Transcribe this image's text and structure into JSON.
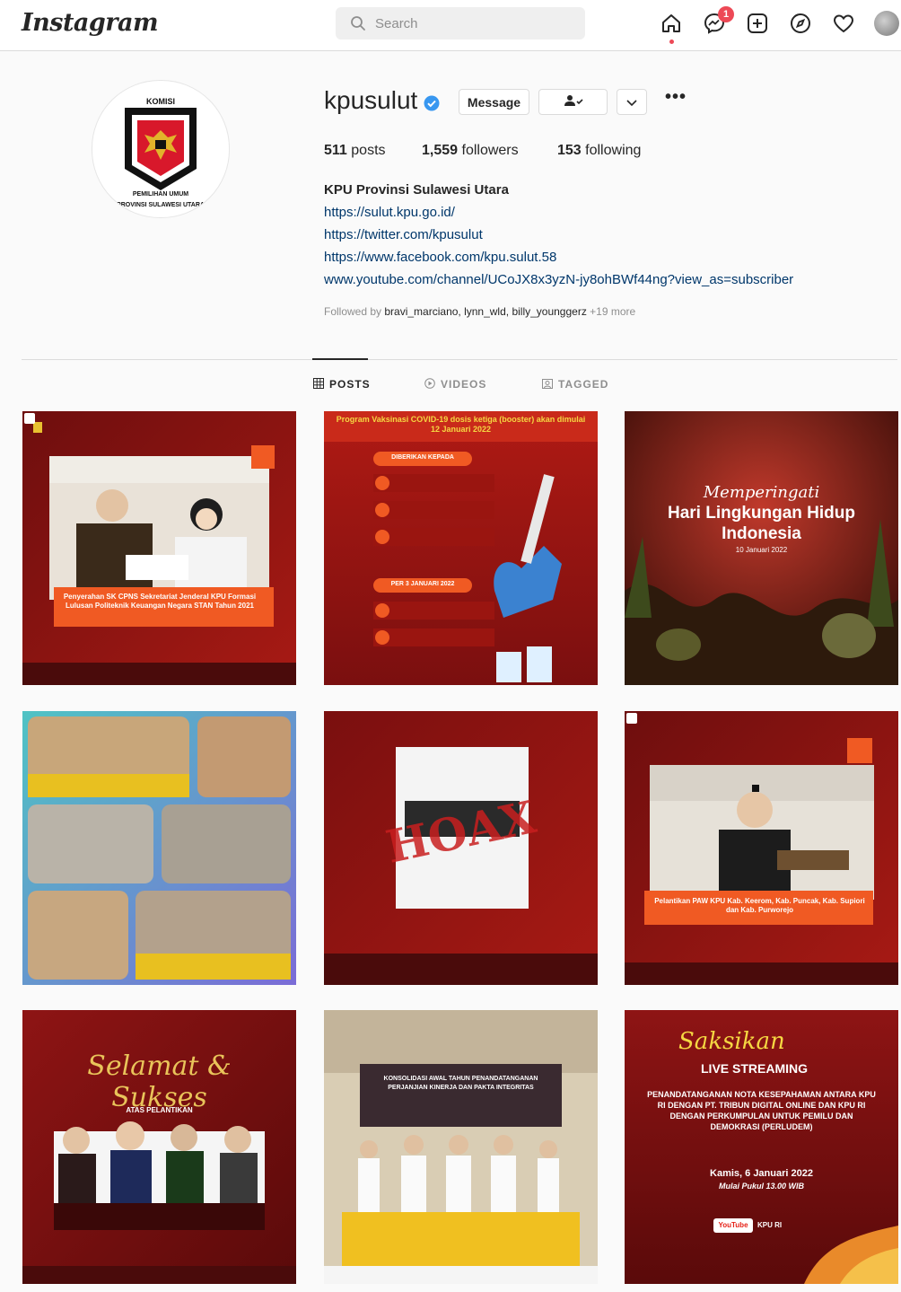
{
  "header": {
    "logo": "Instagram",
    "search_placeholder": "Search",
    "notification_count": "1"
  },
  "profile": {
    "username": "kpusulut",
    "message_label": "Message",
    "stats": [
      {
        "value": "511",
        "label": "posts"
      },
      {
        "value": "1,559",
        "label": "followers"
      },
      {
        "value": "153",
        "label": "following"
      }
    ],
    "logo_top_text": "KOMISI",
    "logo_bottom_text": "PEMILIHAN UMUM",
    "logo_caption": "PROVINSI SULAWESI UTARA",
    "bio_name": "KPU Provinsi Sulawesi Utara",
    "links": [
      "https://sulut.kpu.go.id/",
      "https://twitter.com/kpusulut",
      "https://www.facebook.com/kpu.sulut.58",
      "www.youtube.com/channel/UCoJX8x3yzN-jy8ohBWf44ng?view_as=subscriber"
    ],
    "followed_by_prefix": "Followed by",
    "followed_by_names": "bravi_marciano, lynn_wld, billy_younggerz",
    "followed_by_more": "+19 more"
  },
  "tabs": [
    "POSTS",
    "VIDEOS",
    "TAGGED"
  ],
  "posts": {
    "p1_caption": "Penyerahan SK CPNS Sekretariat Jenderal KPU Formasi Lulusan Politeknik Keuangan Negara STAN Tahun 2021",
    "p2_title": "Program Vaksinasi COVID-19 dosis ketiga (booster) akan dimulai 12 Januari 2022",
    "p2_given": "DIBERIKAN KEPADA",
    "p2_date": "PER 3 JANUARI 2022",
    "p3_script": "Memperingati",
    "p3_title": "Hari Lingkungan Hidup Indonesia",
    "p3_date": "10 Januari 2022",
    "p5_stamp": "HOAX",
    "p6_caption": "Pelantikan PAW KPU Kab. Keerom, Kab. Puncak, Kab. Supiori dan Kab. Purworejo",
    "p7_script": "Selamat & Sukses",
    "p7_sub": "ATAS PELANTIKAN",
    "p8_banner": "KONSOLIDASI AWAL TAHUN PENANDATANGANAN PERJANJIAN KINERJA DAN PAKTA INTEGRITAS",
    "p9_script": "Saksikan",
    "p9_live": "LIVE STREAMING",
    "p9_body": "PENANDATANGANAN NOTA KESEPAHAMAN ANTARA KPU RI DENGAN PT. TRIBUN DIGITAL ONLINE DAN KPU RI DENGAN PERKUMPULAN UNTUK PEMILU DAN DEMOKRASI (PERLUDEM)",
    "p9_date": "Kamis, 6 Januari 2022",
    "p9_time": "Mulai Pukul 13.00 WIB",
    "p9_yt": "YouTube",
    "p9_channel": "KPU RI"
  },
  "colors": {
    "post_red": "#8e1414",
    "post_dark": "#4a0b0b",
    "accent_orange": "#f05a23",
    "link_blue": "#00376b"
  }
}
